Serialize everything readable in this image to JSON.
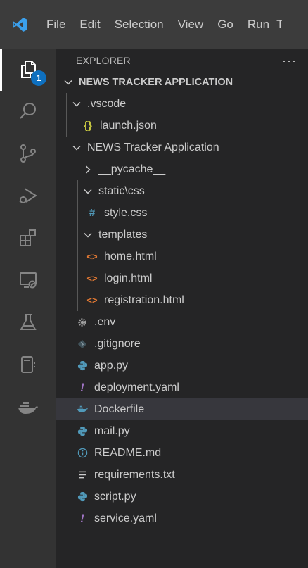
{
  "menu": {
    "items": [
      "File",
      "Edit",
      "Selection",
      "View",
      "Go",
      "Run",
      "T"
    ]
  },
  "activity": {
    "explorer_badge": "1"
  },
  "explorer": {
    "title": "EXPLORER",
    "more": "···",
    "root_folder": "NEWS TRACKER APPLICATION"
  },
  "tree": [
    {
      "label": ".vscode",
      "kind": "folder-open"
    },
    {
      "label": "launch.json",
      "kind": "json"
    },
    {
      "label": "NEWS Tracker Application",
      "kind": "folder-open"
    },
    {
      "label": "__pycache__",
      "kind": "folder-closed"
    },
    {
      "label": "static\\css",
      "kind": "folder-open"
    },
    {
      "label": "style.css",
      "kind": "css"
    },
    {
      "label": "templates",
      "kind": "folder-open"
    },
    {
      "label": "home.html",
      "kind": "html"
    },
    {
      "label": "login.html",
      "kind": "html"
    },
    {
      "label": "registration.html",
      "kind": "html"
    },
    {
      "label": ".env",
      "kind": "env"
    },
    {
      "label": ".gitignore",
      "kind": "git"
    },
    {
      "label": "app.py",
      "kind": "python"
    },
    {
      "label": "deployment.yaml",
      "kind": "yaml"
    },
    {
      "label": "Dockerfile",
      "kind": "docker",
      "selected": true
    },
    {
      "label": "mail.py",
      "kind": "python"
    },
    {
      "label": "README.md",
      "kind": "info"
    },
    {
      "label": "requirements.txt",
      "kind": "text"
    },
    {
      "label": "script.py",
      "kind": "python"
    },
    {
      "label": "service.yaml",
      "kind": "yaml"
    }
  ],
  "icon_glyphs": {
    "json": "{}",
    "css": "#",
    "html": "<>",
    "yaml": "!"
  },
  "colors": {
    "accent": "#0e70c0",
    "json": "#cbcb41",
    "css": "#519aba",
    "html": "#e37933",
    "python": "#519aba",
    "yaml": "#a074c4",
    "docker": "#519aba",
    "settings": "#a0a0a0"
  }
}
